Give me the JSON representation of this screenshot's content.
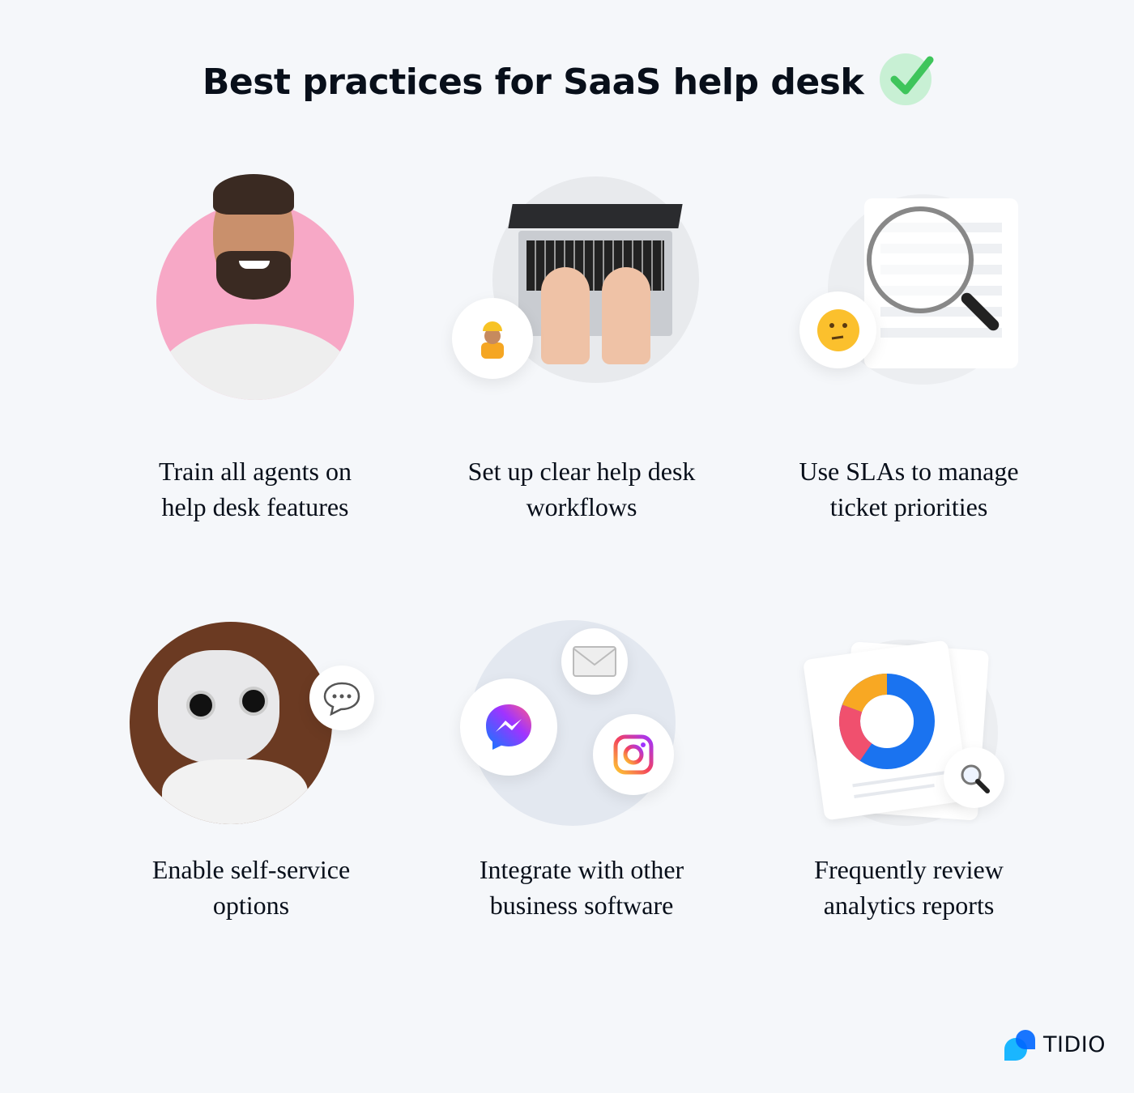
{
  "title": "Best practices for SaaS help desk",
  "title_icon": "check-mark-icon",
  "cards": [
    {
      "caption_lines": [
        "Train all agents on",
        "help desk features"
      ],
      "icon": "agent-photo"
    },
    {
      "caption_lines": [
        "Set up clear help desk",
        "workflows"
      ],
      "icon": "laptop-typing"
    },
    {
      "caption_lines": [
        "Use SLAs to manage",
        "ticket priorities"
      ],
      "icon": "magnifying-glass"
    },
    {
      "caption_lines": [
        "Enable self-service",
        "options"
      ],
      "icon": "robot"
    },
    {
      "caption_lines": [
        "Integrate with other",
        "business software"
      ],
      "icon": "messenger-mail-instagram"
    },
    {
      "caption_lines": [
        "Frequently review",
        "analytics reports"
      ],
      "icon": "donut-chart-report"
    }
  ],
  "colors": {
    "accent_green": "#3ec55b",
    "pink": "#f7a8c6",
    "blue": "#1a73f0",
    "brand_blue": "#0066ff"
  },
  "logo": {
    "text": "TIDIO"
  }
}
